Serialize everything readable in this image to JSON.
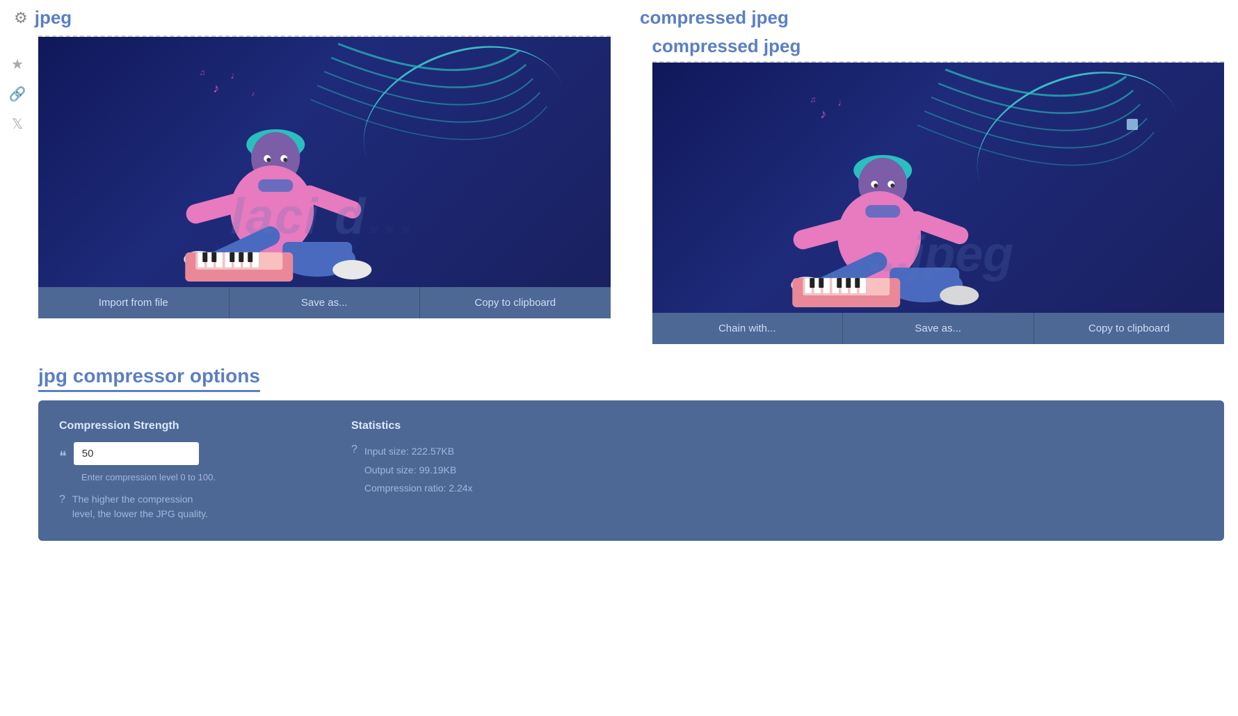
{
  "left_panel": {
    "title": "jpeg",
    "buttons": {
      "import": "Import from file",
      "save": "Save as...",
      "copy": "Copy to clipboard"
    }
  },
  "right_panel": {
    "title": "compressed jpeg",
    "buttons": {
      "chain": "Chain with...",
      "save": "Save as...",
      "copy": "Copy to clipboard"
    }
  },
  "options": {
    "title": "jpg compressor options",
    "compression": {
      "label": "Compression Strength",
      "value": "50",
      "placeholder": "50",
      "hint": "Enter compression level 0 to 100.",
      "help": "The higher the compression\nlevel, the lower the JPG quality."
    },
    "statistics": {
      "label": "Statistics",
      "input_size": "Input size: 222.57KB",
      "output_size": "Output size: 99.19KB",
      "compression_ratio": "Compression ratio: 2.24x"
    }
  },
  "sidebar": {
    "icons": [
      "gear",
      "star",
      "link",
      "twitter"
    ]
  },
  "watermark_left": "laci d...",
  "watermark_right": "...jpeg"
}
